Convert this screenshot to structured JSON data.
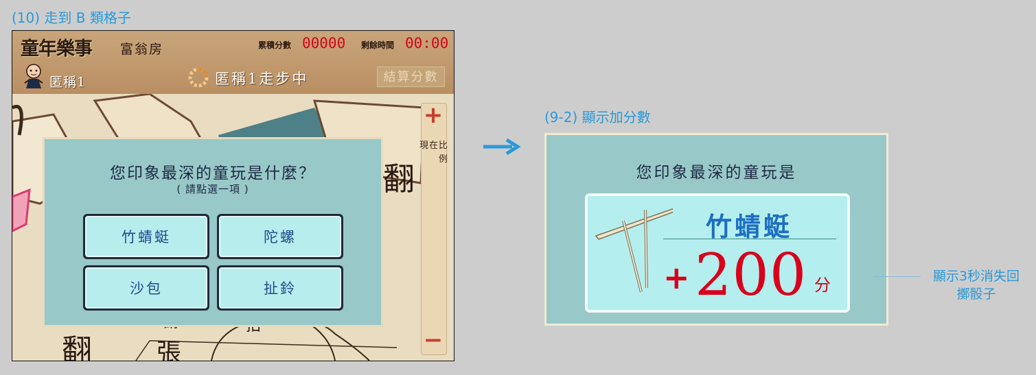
{
  "captions": {
    "left": "(10) 走到 B 類格子",
    "right": "(9-2) 顯示加分數"
  },
  "game": {
    "logo_text": "童年樂事",
    "room": "富翁房",
    "score_label": "累積分數",
    "score_value": "00000",
    "time_label": "剩餘時間",
    "time_value": "00:00",
    "player_name": "匿稱1",
    "turn_status": "匿稱1走步中",
    "settle_button": "結算分數",
    "zoom_in": "+",
    "zoom_out": "−",
    "zoom_label": "現在比例",
    "map_texts": [
      "翻",
      "翻",
      "張",
      "請",
      "拍"
    ],
    "question": {
      "title": "您印象最深的童玩是什麼？",
      "hint": "( 請點選一項 )",
      "options": [
        "竹蜻蜓",
        "陀螺",
        "沙包",
        "扯鈴"
      ]
    }
  },
  "popup": {
    "title": "您印象最深的童玩是",
    "toy_name": "竹蜻蜓",
    "plus": "+",
    "points": "200",
    "unit": "分"
  },
  "note": "顯示3秒消失回擲骰子",
  "colors": {
    "accent_blue": "#2a9ad8",
    "score_red": "#d8001b",
    "dialog_teal": "#98c8c8",
    "option_fill": "#b8edee"
  },
  "icons": [
    "avatar-icon",
    "loading-spinner-icon",
    "arrow-right-icon",
    "bamboo-dragonfly-icon"
  ]
}
